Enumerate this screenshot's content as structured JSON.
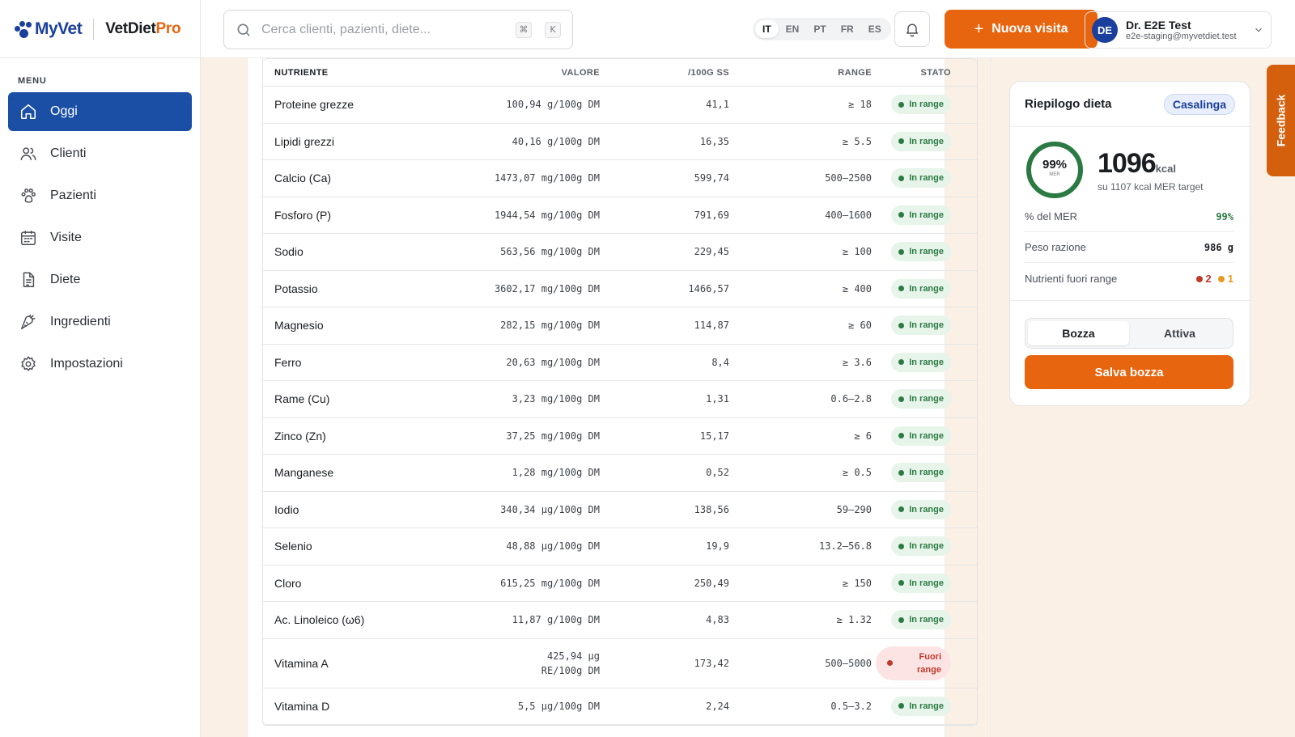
{
  "brand": {
    "myvet": "MyVet",
    "vdp_main": "VetDiet",
    "vdp_pro": "Pro"
  },
  "sidebar": {
    "heading": "MENU",
    "items": [
      {
        "label": "Oggi",
        "icon": "home-icon",
        "active": true
      },
      {
        "label": "Clienti",
        "icon": "users-icon"
      },
      {
        "label": "Pazienti",
        "icon": "paw-icon"
      },
      {
        "label": "Visite",
        "icon": "calendar-icon"
      },
      {
        "label": "Diete",
        "icon": "document-icon"
      },
      {
        "label": "Ingredienti",
        "icon": "carrot-icon"
      },
      {
        "label": "Impostazioni",
        "icon": "gear-icon"
      }
    ]
  },
  "header": {
    "search_placeholder": "Cerca clienti, pazienti, diete...",
    "shortcut_keys": [
      "⌘",
      "K"
    ],
    "languages": [
      "IT",
      "EN",
      "PT",
      "FR",
      "ES"
    ],
    "active_language": "IT",
    "new_visit_label": "Nuova visita",
    "user": {
      "initials": "DE",
      "name": "Dr. E2E Test",
      "email": "e2e-staging@myvetdiet.test"
    }
  },
  "table": {
    "columns": [
      "NUTRIENTE",
      "VALORE",
      "/100G SS",
      "RANGE",
      "STATO"
    ],
    "rows": [
      {
        "name": "Proteine grezze",
        "value": "100,94 g/100g DM",
        "per100": "41,1",
        "range": "≥ 18",
        "status": "In range",
        "ok": true
      },
      {
        "name": "Lipidi grezzi",
        "value": "40,16 g/100g DM",
        "per100": "16,35",
        "range": "≥ 5.5",
        "status": "In range",
        "ok": true
      },
      {
        "name": "Calcio (Ca)",
        "value": "1473,07 mg/100g DM",
        "per100": "599,74",
        "range": "500–2500",
        "status": "In range",
        "ok": true
      },
      {
        "name": "Fosforo (P)",
        "value": "1944,54 mg/100g DM",
        "per100": "791,69",
        "range": "400–1600",
        "status": "In range",
        "ok": true
      },
      {
        "name": "Sodio",
        "value": "563,56 mg/100g DM",
        "per100": "229,45",
        "range": "≥ 100",
        "status": "In range",
        "ok": true
      },
      {
        "name": "Potassio",
        "value": "3602,17 mg/100g DM",
        "per100": "1466,57",
        "range": "≥ 400",
        "status": "In range",
        "ok": true
      },
      {
        "name": "Magnesio",
        "value": "282,15 mg/100g DM",
        "per100": "114,87",
        "range": "≥ 60",
        "status": "In range",
        "ok": true
      },
      {
        "name": "Ferro",
        "value": "20,63 mg/100g DM",
        "per100": "8,4",
        "range": "≥ 3.6",
        "status": "In range",
        "ok": true
      },
      {
        "name": "Rame (Cu)",
        "value": "3,23 mg/100g DM",
        "per100": "1,31",
        "range": "0.6–2.8",
        "status": "In range",
        "ok": true
      },
      {
        "name": "Zinco (Zn)",
        "value": "37,25 mg/100g DM",
        "per100": "15,17",
        "range": "≥ 6",
        "status": "In range",
        "ok": true
      },
      {
        "name": "Manganese",
        "value": "1,28 mg/100g DM",
        "per100": "0,52",
        "range": "≥ 0.5",
        "status": "In range",
        "ok": true
      },
      {
        "name": "Iodio",
        "value": "340,34 µg/100g DM",
        "per100": "138,56",
        "range": "59–290",
        "status": "In range",
        "ok": true
      },
      {
        "name": "Selenio",
        "value": "48,88 µg/100g DM",
        "per100": "19,9",
        "range": "13.2–56.8",
        "status": "In range",
        "ok": true
      },
      {
        "name": "Cloro",
        "value": "615,25 mg/100g DM",
        "per100": "250,49",
        "range": "≥ 150",
        "status": "In range",
        "ok": true
      },
      {
        "name": "Ac. Linoleico (ω6)",
        "value": "11,87 g/100g DM",
        "per100": "4,83",
        "range": "≥ 1.32",
        "status": "In range",
        "ok": true
      },
      {
        "name": "Vitamina A",
        "value": "425,94 µg RE/100g DM",
        "per100": "173,42",
        "range": "500–5000",
        "status": "Fuori range",
        "ok": false
      },
      {
        "name": "Vitamina D",
        "value": "5,5 µg/100g DM",
        "per100": "2,24",
        "range": "0.5–3.2",
        "status": "In range",
        "ok": true
      }
    ]
  },
  "summary": {
    "title": "Riepilogo dieta",
    "diet_type": "Casalinga",
    "gauge_pct": "99%",
    "gauge_fraction": 0.99,
    "gauge_label": "MER",
    "kcal": "1096",
    "kcal_unit": "kcal",
    "kcal_sub": "su 1107 kcal MER target",
    "mer_label": "% del MER",
    "mer_value": "99%",
    "weight_label": "Peso razione",
    "weight_value": "986 g",
    "out_label": "Nutrienti fuori range",
    "out_red": "2",
    "out_amber": "1",
    "toggle": [
      "Bozza",
      "Attiva"
    ],
    "toggle_active": "Bozza",
    "save_label": "Salva bozza"
  },
  "feedback_label": "Feedback",
  "colors": {
    "primary": "#1a4fa5",
    "accent": "#e8650f",
    "ok": "#2c7a43",
    "bad": "#c0392b"
  }
}
